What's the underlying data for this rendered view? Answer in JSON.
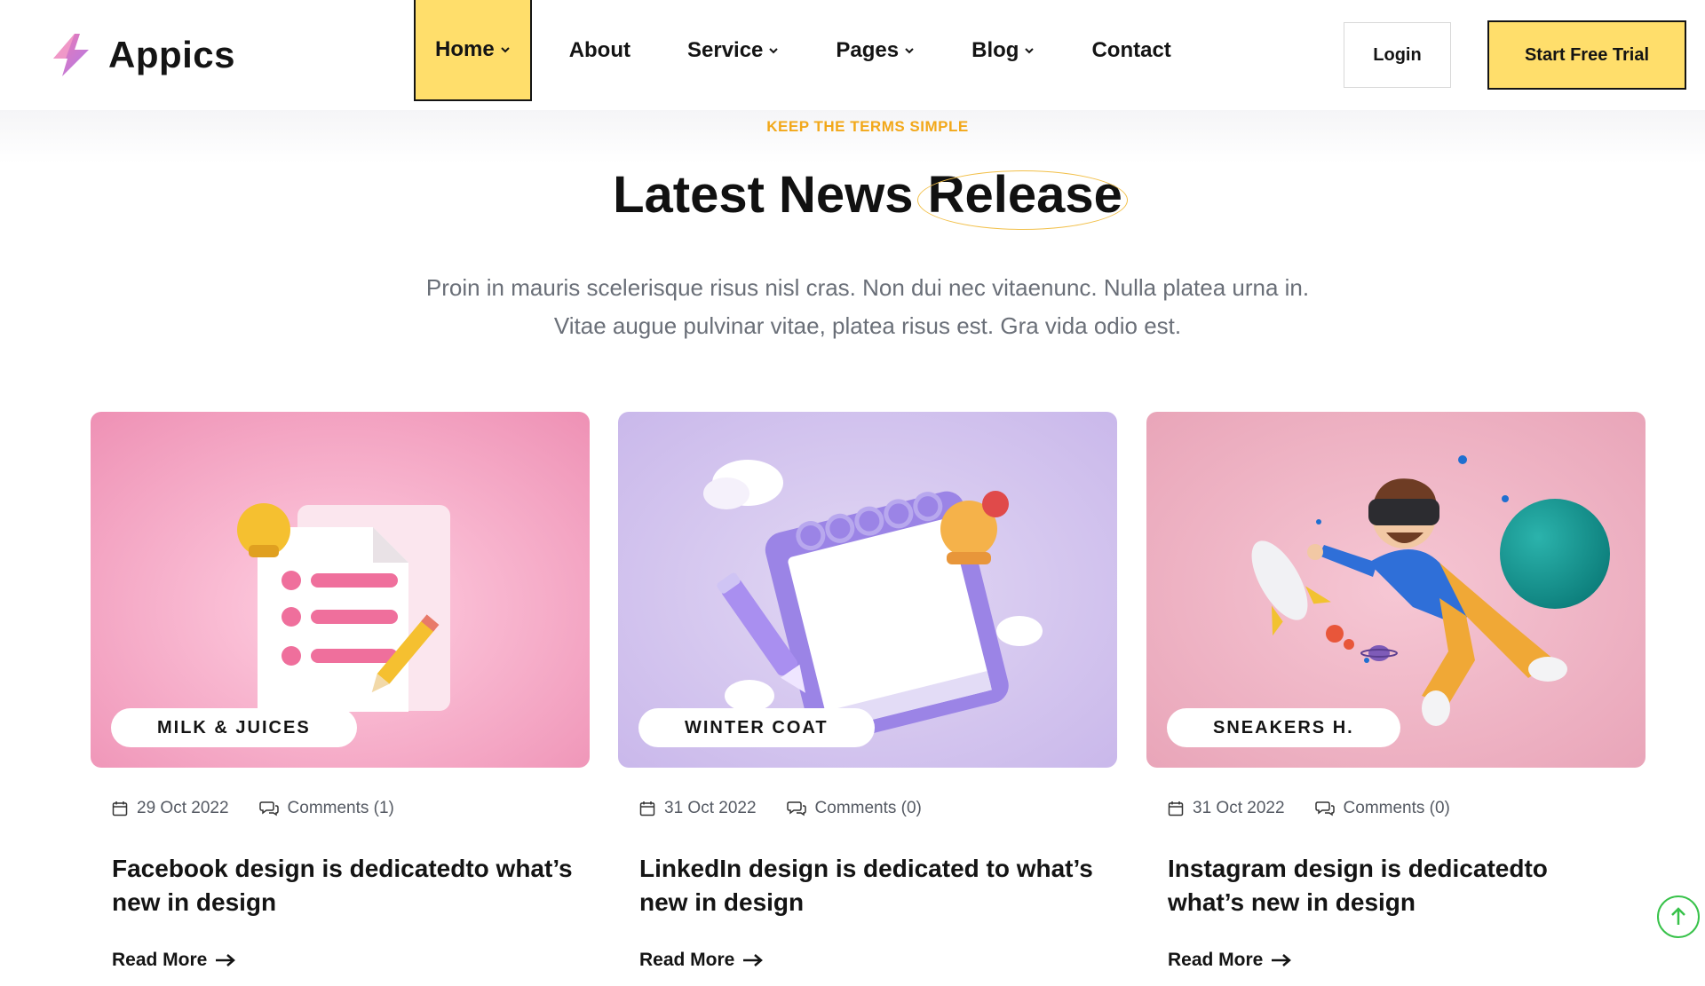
{
  "brand": {
    "name": "Appics"
  },
  "nav": {
    "items": [
      {
        "label": "Home",
        "has_dropdown": true,
        "active": true
      },
      {
        "label": "About",
        "has_dropdown": false
      },
      {
        "label": "Service",
        "has_dropdown": true
      },
      {
        "label": "Pages",
        "has_dropdown": true
      },
      {
        "label": "Blog",
        "has_dropdown": true
      },
      {
        "label": "Contact",
        "has_dropdown": false
      }
    ]
  },
  "header": {
    "login_label": "Login",
    "trial_label": "Start Free Trial"
  },
  "section": {
    "eyebrow": "KEEP THE TERMS SIMPLE",
    "title_main": "Latest News ",
    "title_highlight": "Release",
    "subtitle_line1": "Proin in mauris scelerisque risus nisl cras. Non dui nec vitaenunc. Nulla platea urna in.",
    "subtitle_line2": "Vitae augue pulvinar vitae, platea risus est. Gra vida odio est."
  },
  "cards": [
    {
      "tag": "MILK & JUICES",
      "date": "29 Oct 2022",
      "comments": "Comments (1)",
      "title": "Facebook design is dedicatedto what’s new in design",
      "read_more": "Read More",
      "image_theme": "pink-document"
    },
    {
      "tag": "WINTER COAT",
      "date": "31 Oct 2022",
      "comments": "Comments (0)",
      "title": "LinkedIn design is dedicated to what’s new in design",
      "read_more": "Read More",
      "image_theme": "purple-notepad"
    },
    {
      "tag": "SNEAKERS H.",
      "date": "31 Oct 2022",
      "comments": "Comments (0)",
      "title": "Instagram design is dedicatedto what’s new in design",
      "read_more": "Read More",
      "image_theme": "pink-vr-man"
    }
  ],
  "colors": {
    "accent_yellow": "#ffde6b",
    "eyebrow_orange": "#f2a81a",
    "scroll_green": "#38c24a",
    "text_dark": "#141414"
  },
  "icons": {
    "logo": "lightning-logo-icon",
    "chevron": "chevron-down-icon",
    "calendar": "calendar-icon",
    "comments": "comments-icon",
    "arrow": "arrow-right-icon",
    "scroll_top": "arrow-up-icon"
  }
}
